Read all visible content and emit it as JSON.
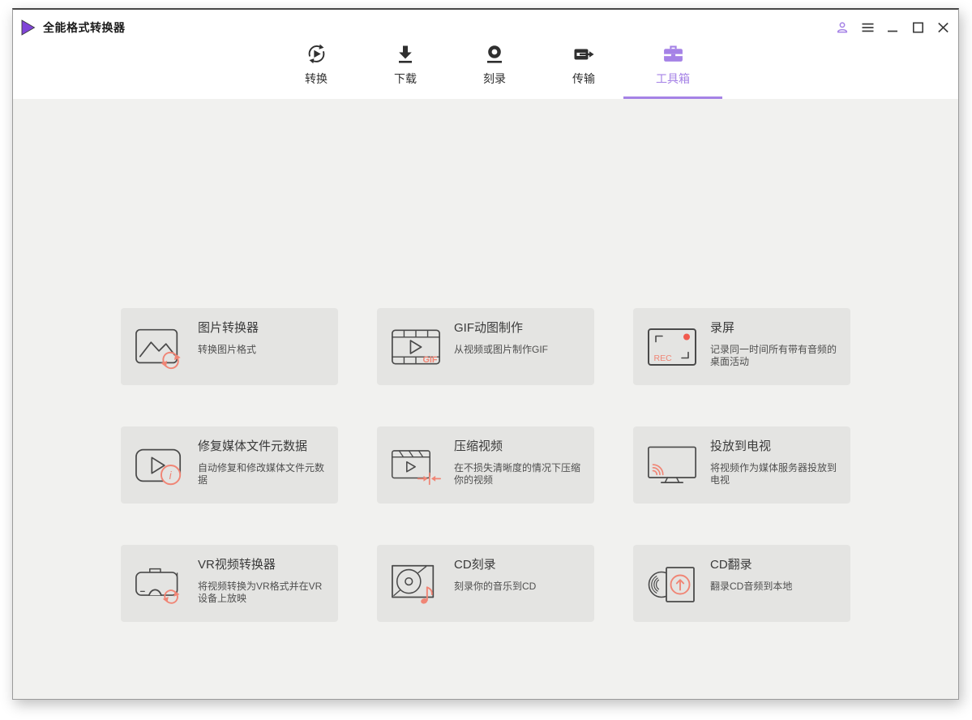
{
  "app": {
    "title": "全能格式转换器"
  },
  "titlebar": {
    "icons": [
      "account-icon",
      "menu-icon",
      "minimize-icon",
      "maximize-icon",
      "close-icon"
    ]
  },
  "nav": {
    "active_index": 4,
    "tabs": [
      {
        "label": "转换",
        "icon": "convert-icon"
      },
      {
        "label": "下载",
        "icon": "download-icon"
      },
      {
        "label": "刻录",
        "icon": "burn-icon"
      },
      {
        "label": "传输",
        "icon": "transfer-icon"
      },
      {
        "label": "工具箱",
        "icon": "toolbox-icon"
      }
    ]
  },
  "tools": [
    {
      "title": "图片转换器",
      "desc": "转换图片格式",
      "icon": "image-converter-icon"
    },
    {
      "title": "GIF动图制作",
      "desc": "从视频或图片制作GIF",
      "icon": "gif-maker-icon"
    },
    {
      "title": "录屏",
      "desc": "记录同一时间所有带有音频的桌面活动",
      "icon": "screen-recorder-icon"
    },
    {
      "title": "修复媒体文件元数据",
      "desc": "自动修复和修改媒体文件元数据",
      "icon": "fix-metadata-icon"
    },
    {
      "title": "压缩视频",
      "desc": "在不损失清晰度的情况下压缩你的视频",
      "icon": "compress-video-icon"
    },
    {
      "title": "投放到电视",
      "desc": "将视频作为媒体服务器投放到电视",
      "icon": "cast-to-tv-icon"
    },
    {
      "title": "VR视频转换器",
      "desc": "将视频转换为VR格式并在VR设备上放映",
      "icon": "vr-converter-icon"
    },
    {
      "title": "CD刻录",
      "desc": "刻录你的音乐到CD",
      "icon": "cd-burn-icon"
    },
    {
      "title": "CD翻录",
      "desc": "翻录CD音频到本地",
      "icon": "cd-rip-icon"
    }
  ],
  "icon_labels": {
    "gif": "GIF",
    "rec": "REC",
    "info": "i"
  },
  "colors": {
    "accent_purple": "#a582e6",
    "logo_purple": "#8044d8",
    "accent_coral": "#f08575",
    "record_red": "#f15a4e",
    "icon_stroke": "#4a4a4a",
    "card_bg": "#e4e4e2",
    "content_bg": "#f1f1ef",
    "header_bg": "#ffffff"
  }
}
